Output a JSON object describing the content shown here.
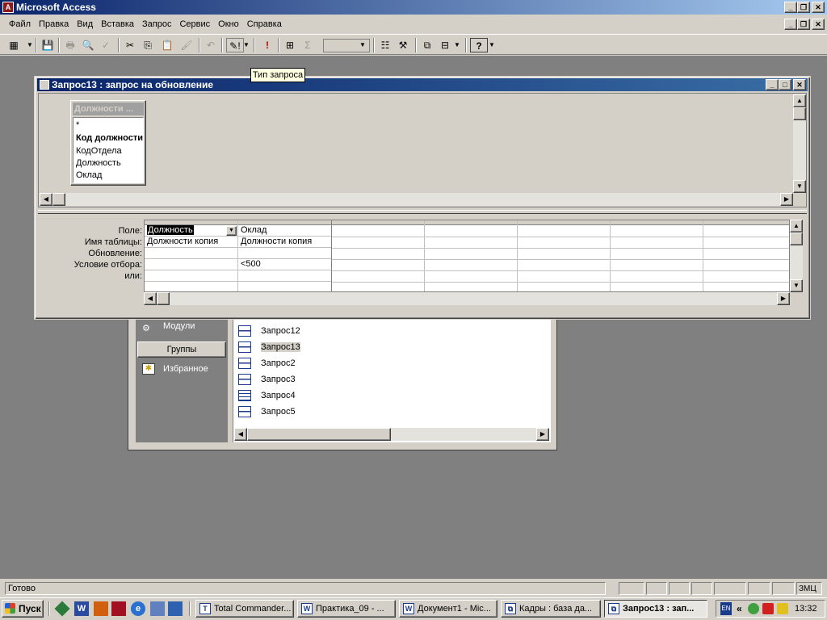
{
  "app": {
    "title": "Microsoft Access",
    "icon_glyph": "A"
  },
  "menu": [
    {
      "label": "Файл"
    },
    {
      "label": "Правка"
    },
    {
      "label": "Вид"
    },
    {
      "label": "Вставка"
    },
    {
      "label": "Запрос"
    },
    {
      "label": "Сервис"
    },
    {
      "label": "Окно"
    },
    {
      "label": "Справка"
    }
  ],
  "tooltip": "Тип запроса",
  "query_window": {
    "title": "Запрос13 : запрос на обновление",
    "field_list": {
      "title": "Должности ...",
      "fields": [
        "*",
        "Код должности",
        "КодОтдела",
        "Должность",
        "Оклад"
      ]
    },
    "grid_labels": [
      "Поле:",
      "Имя таблицы:",
      "Обновление:",
      "Условие отбора:",
      "или:"
    ],
    "columns": [
      {
        "field": "Должность",
        "table": "Должности копия",
        "update": "",
        "criteria": "",
        "or": ""
      },
      {
        "field": "Оклад",
        "table": "Должности копия",
        "update": "",
        "criteria": "<500",
        "or": ""
      }
    ]
  },
  "db_window": {
    "sidebar": [
      {
        "label": "Модули",
        "icon": "modules-icon"
      },
      {
        "label": "Избранное",
        "icon": "favorites-icon"
      }
    ],
    "groups_label": "Группы",
    "items": [
      {
        "label": "Запрос12",
        "icon": "query-icon"
      },
      {
        "label": "Запрос13",
        "icon": "query-icon",
        "selected": true
      },
      {
        "label": "Запрос2",
        "icon": "query-icon"
      },
      {
        "label": "Запрос3",
        "icon": "query-icon"
      },
      {
        "label": "Запрос4",
        "icon": "table-query-icon"
      },
      {
        "label": "Запрос5",
        "icon": "query-icon"
      }
    ]
  },
  "status": {
    "text": "Готово",
    "mode": "ЗМЦ"
  },
  "taskbar": {
    "start_label": "Пуск",
    "tasks": [
      {
        "label": "Total Commander...",
        "icon": "total-commander-icon"
      },
      {
        "label": "Практика_09 - ...",
        "icon": "word-icon"
      },
      {
        "label": "Документ1 - Mic...",
        "icon": "word-icon"
      },
      {
        "label": "Кадры : база да...",
        "icon": "access-db-icon"
      },
      {
        "label": "Запрос13 : зап...",
        "icon": "access-query-icon",
        "active": true
      }
    ],
    "lang": "EN",
    "clock": "13:32"
  }
}
